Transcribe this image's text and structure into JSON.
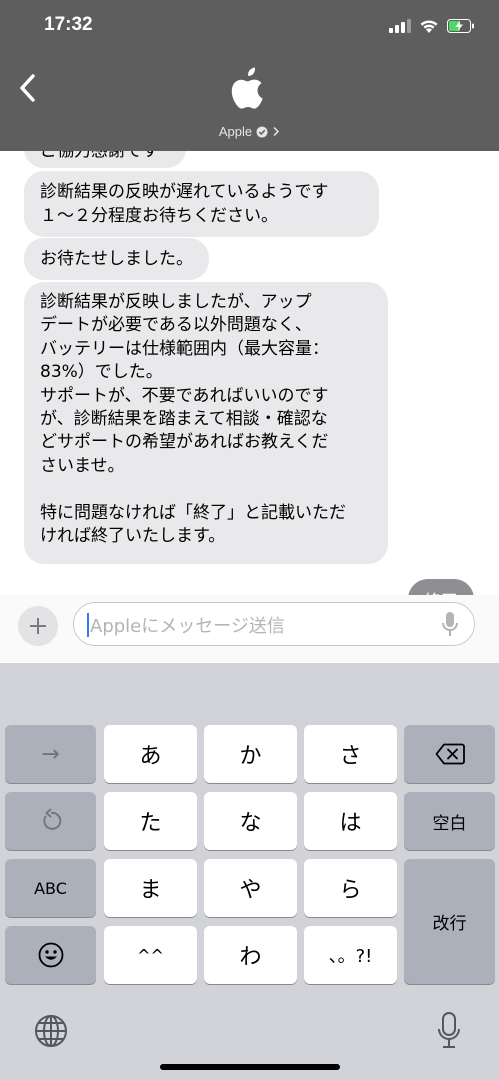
{
  "status_bar": {
    "time": "17:32"
  },
  "header": {
    "contact_name": "Apple"
  },
  "messages": [
    {
      "text": "ご協力感謝です"
    },
    {
      "text": "診断結果の反映が遅れているようです\n１〜２分程度お待ちください。"
    },
    {
      "text": "お待たせしました。"
    },
    {
      "text": "診断結果が反映しましたが、アップ\nデートが必要である以外問題なく、\nバッテリーは仕様範囲内（最大容量：\n83%）でした。\nサポートが、不要であればいいのです\nが、診断結果を踏まえて相談・確認な\nどサポートの希望があればお教えくだ\nさいませ。\n\n特に問題なければ「終了」と記載いただ\nければ終了いたします。"
    },
    {
      "text": "終了"
    }
  ],
  "input": {
    "placeholder": "Appleにメッセージ送信"
  },
  "keyboard": {
    "row1": [
      "→",
      "あ",
      "か",
      "さ"
    ],
    "row2": [
      "た",
      "な",
      "は",
      "空白"
    ],
    "row3": [
      "ABC",
      "ま",
      "や",
      "ら",
      "改行"
    ],
    "row4": [
      "^^",
      "わ",
      "、。?!"
    ]
  },
  "colors": {
    "header_bg": "#5e5e5e",
    "received_bubble": "#e9e9eb",
    "sent_bubble": "#8e8e93",
    "keyboard_bg": "#d1d3d9"
  }
}
